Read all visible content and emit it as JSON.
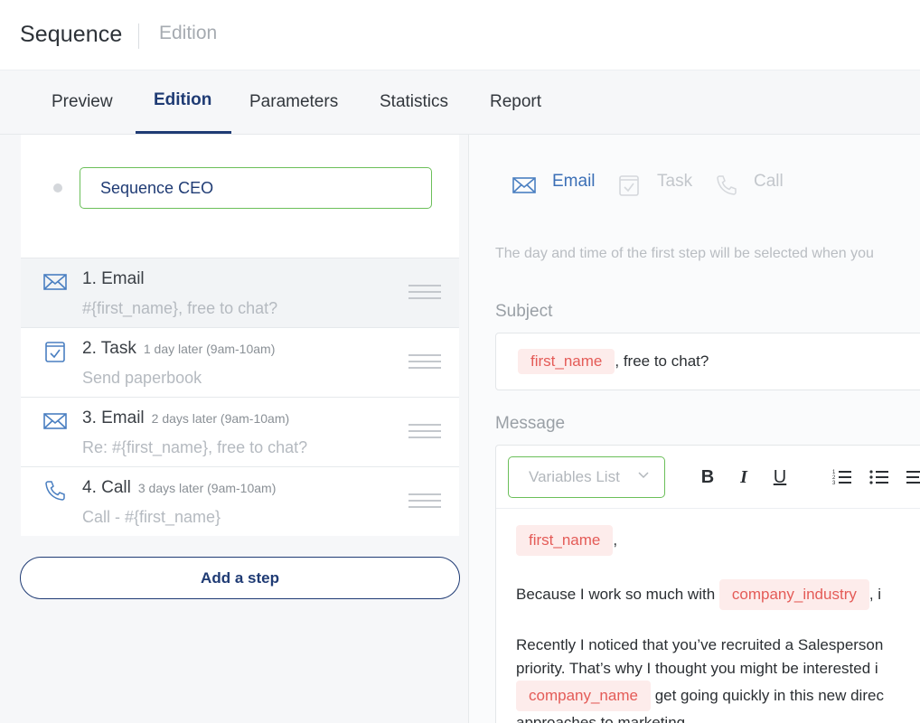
{
  "header": {
    "title": "Sequence",
    "subtitle": "Edition"
  },
  "tabs": [
    {
      "label": "Preview"
    },
    {
      "label": "Edition"
    },
    {
      "label": "Parameters"
    },
    {
      "label": "Statistics"
    },
    {
      "label": "Report"
    }
  ],
  "sequence": {
    "name": "Sequence CEO"
  },
  "steps": [
    {
      "title": "1. Email",
      "delay": "",
      "subtitle": "#{first_name}, free to chat?"
    },
    {
      "title": "2. Task",
      "delay": "1 day later (9am-10am)",
      "subtitle": "Send paperbook"
    },
    {
      "title": "3. Email",
      "delay": "2 days later (9am-10am)",
      "subtitle": "Re: #{first_name}, free to chat?"
    },
    {
      "title": "4. Call",
      "delay": "3 days later (9am-10am)",
      "subtitle": "Call - #{first_name}"
    }
  ],
  "add_step_label": "Add a step",
  "step_types": {
    "email": "Email",
    "task": "Task",
    "call": "Call"
  },
  "hint": "The day and time of the first step will be selected when you",
  "subject": {
    "label": "Subject",
    "variable": "first_name",
    "text": ", free to chat?"
  },
  "message": {
    "label": "Message",
    "variables_placeholder": "Variables List",
    "line1_var": "first_name",
    "line1_text": ",",
    "line2_text": "Because I work so much with",
    "line2_var": "company_industry",
    "line2_tail": ", i",
    "line3_text": "Recently I noticed that you’ve recruited a Salesperson",
    "line4_text": "priority. That’s why I thought you might be interested i",
    "line5_var": "company_name",
    "line5_text": "get going quickly in this new direc",
    "line6_text": "approaches to marketing."
  },
  "colors": {
    "accent": "#1f3b74",
    "green": "#6bbf59",
    "chip_bg": "#fdeceb",
    "chip_text": "#e45b57"
  }
}
